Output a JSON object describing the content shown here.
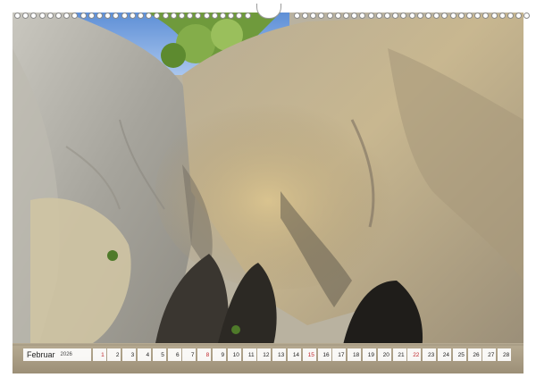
{
  "calendar": {
    "month": "Februar",
    "year": "2026",
    "days": [
      {
        "n": "1",
        "sun": true
      },
      {
        "n": "2"
      },
      {
        "n": "3"
      },
      {
        "n": "4"
      },
      {
        "n": "5"
      },
      {
        "n": "6"
      },
      {
        "n": "7"
      },
      {
        "n": "8",
        "sun": true
      },
      {
        "n": "9"
      },
      {
        "n": "10"
      },
      {
        "n": "11"
      },
      {
        "n": "12"
      },
      {
        "n": "13"
      },
      {
        "n": "14"
      },
      {
        "n": "15",
        "sun": true
      },
      {
        "n": "16"
      },
      {
        "n": "17"
      },
      {
        "n": "18"
      },
      {
        "n": "19"
      },
      {
        "n": "20"
      },
      {
        "n": "21"
      },
      {
        "n": "22",
        "sun": true
      },
      {
        "n": "23"
      },
      {
        "n": "24"
      },
      {
        "n": "25"
      },
      {
        "n": "26"
      },
      {
        "n": "27"
      },
      {
        "n": "28"
      }
    ],
    "sunday_color": "#c0272d"
  }
}
